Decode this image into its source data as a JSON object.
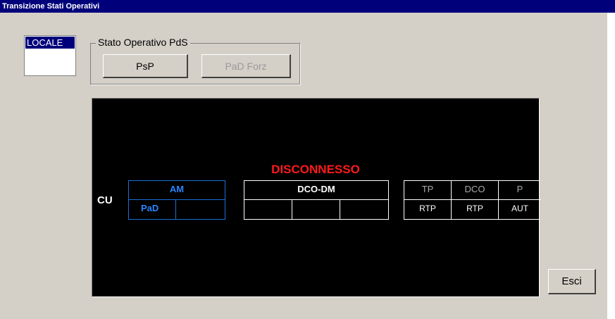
{
  "window": {
    "title": "Transizione Stati Operativi"
  },
  "mode_list": {
    "items": [
      "LOCALE"
    ]
  },
  "stato_operativo": {
    "legend": "Stato Operativo PdS",
    "buttons": [
      {
        "label": "PsP",
        "enabled": true
      },
      {
        "label": "PaD Forz",
        "enabled": false
      }
    ]
  },
  "status_panel": {
    "status_text": "DISCONNESSO",
    "status_color": "#ff1a1a",
    "row_label": "CU",
    "am": {
      "title": "AM",
      "cells": [
        "PaD",
        ""
      ],
      "color": "#2a85ff"
    },
    "dco_dm": {
      "title": "DCO-DM",
      "cells": [
        "",
        "",
        ""
      ]
    },
    "right_group": {
      "headers": [
        "TP",
        "DCO",
        "P"
      ],
      "values": [
        "RTP",
        "RTP",
        "AUT"
      ]
    }
  },
  "footer": {
    "exit_label": "Esci"
  }
}
